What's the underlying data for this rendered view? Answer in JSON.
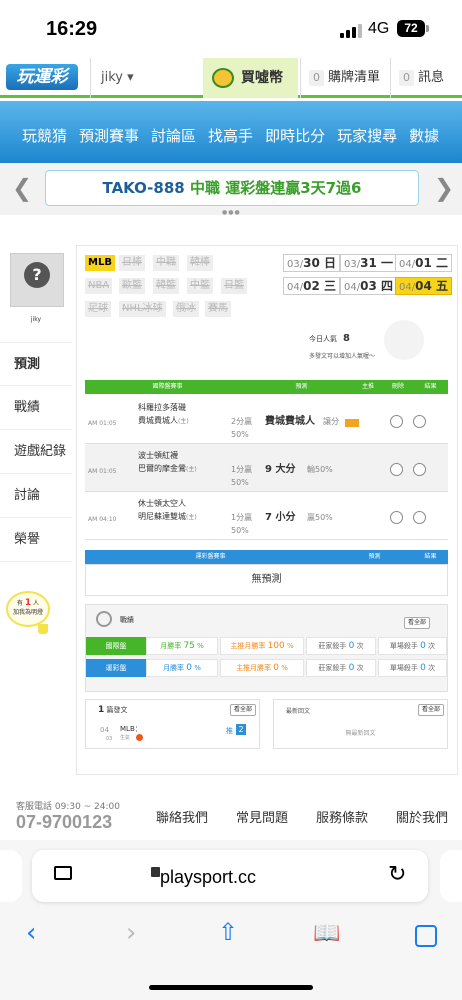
{
  "status": {
    "time": "16:29",
    "network": "4G",
    "battery": "72"
  },
  "header": {
    "logo": "玩運彩",
    "user": "jiky ▾",
    "coin_button": "買噓幣",
    "list_count": "0",
    "list_label": "購牌清單",
    "msg_count": "0",
    "msg_label": "訊息"
  },
  "nav": {
    "items": [
      "玩競猜",
      "預測賽事",
      "討論區",
      "找高手",
      "即時比分",
      "玩家搜尋",
      "數據"
    ]
  },
  "banner": {
    "part1": "TAKO-888",
    "part2": "中職",
    "part3": "運彩盤連贏3天7過6"
  },
  "profile": {
    "username": "jiky"
  },
  "side_tabs": [
    "預測",
    "戰績",
    "遊戲紀錄",
    "討論",
    "榮譽"
  ],
  "invite": {
    "line1": "有",
    "count": "1",
    "unit": "人",
    "line2": "加我為明燈"
  },
  "leagues": [
    {
      "label": "MLB",
      "active": true
    },
    {
      "label": "日棒",
      "active": false
    },
    {
      "label": "中職",
      "active": false
    },
    {
      "label": "韓棒",
      "active": false
    },
    {
      "label": "NBA",
      "active": false
    },
    {
      "label": "歐籃",
      "active": false
    },
    {
      "label": "韓籃",
      "active": false
    },
    {
      "label": "中籃",
      "active": false
    },
    {
      "label": "日籃",
      "active": false
    },
    {
      "label": "足球",
      "active": false
    },
    {
      "label": "NHL冰球",
      "active": false
    },
    {
      "label": "俄冰",
      "active": false
    },
    {
      "label": "賽馬",
      "active": false
    }
  ],
  "dates": [
    {
      "prefix": "03/",
      "day": "30 日",
      "active": false
    },
    {
      "prefix": "03/",
      "day": "31 一",
      "active": false
    },
    {
      "prefix": "04/",
      "day": "01 二",
      "active": false
    },
    {
      "prefix": "04/",
      "day": "02 三",
      "active": false
    },
    {
      "prefix": "04/",
      "day": "03 四",
      "active": false
    },
    {
      "prefix": "04/",
      "day": "04 五",
      "active": true
    }
  ],
  "popularity": {
    "label": "今日人氣",
    "value": "8",
    "tip": "多發文可以增加人氣喔～"
  },
  "intl_table": {
    "headers": [
      "國際盤賽事",
      "預測",
      "主推",
      "刪除",
      "結果"
    ],
    "rows": [
      {
        "time": "AM 01:05",
        "team1": "科羅拉多落磯",
        "team2": "費城費城人",
        "team2_mark": "(主)",
        "line1": "2分贏",
        "line2": "50%",
        "pick": "費城費城人",
        "pick_note": "讓分"
      },
      {
        "time": "AM 01:05",
        "team1": "波士頓紅襪",
        "team2": "巴爾的摩金鶯",
        "team2_mark": "(主)",
        "line1": "1分贏",
        "line2": "50%",
        "pick": "9 大分",
        "pick_note": "輸50%"
      },
      {
        "time": "AM 04:10",
        "team1": "休士頓太空人",
        "team2": "明尼蘇達雙城",
        "team2_mark": "(主)",
        "line1": "1分贏",
        "line2": "50%",
        "pick": "7 小分",
        "pick_note": "贏50%"
      }
    ]
  },
  "lottery_table": {
    "headers": [
      "運彩盤賽事",
      "預測",
      "結果"
    ],
    "empty": "無預測"
  },
  "stats": {
    "title": "戰績",
    "view_all": "看全部",
    "rows": [
      {
        "label": "國際盤",
        "color": "#47b52a",
        "month_label": "月勝率",
        "month": "75",
        "main_label": "主推月勝率",
        "main": "100",
        "banker_label": "莊家殺手",
        "banker": "0",
        "single_label": "單場殺手",
        "single": "0"
      },
      {
        "label": "運彩盤",
        "color": "#2b8fd9",
        "month_label": "月勝率",
        "month": "0",
        "main_label": "主推月勝率",
        "main": "0",
        "banker_label": "莊家殺手",
        "banker": "0",
        "single_label": "單場殺手",
        "single": "0"
      }
    ],
    "pct": "%",
    "unit": "次"
  },
  "posts": {
    "count": "1",
    "label": "篇發文",
    "view_all": "看全部",
    "day": "04",
    "month": "03",
    "league": "MLB：",
    "tag": "生氣",
    "reply_label": "推",
    "reply_count": "2"
  },
  "replies": {
    "title": "最新回文",
    "view_all": "看全部",
    "empty": "無最新回文"
  },
  "footer": {
    "service_label": "客服電話 09:30 ~ 24:00",
    "phone": "07-9700123",
    "links": [
      "聯絡我們",
      "常見問題",
      "服務條款",
      "關於我們"
    ]
  },
  "browser": {
    "url": "playsport.cc"
  }
}
